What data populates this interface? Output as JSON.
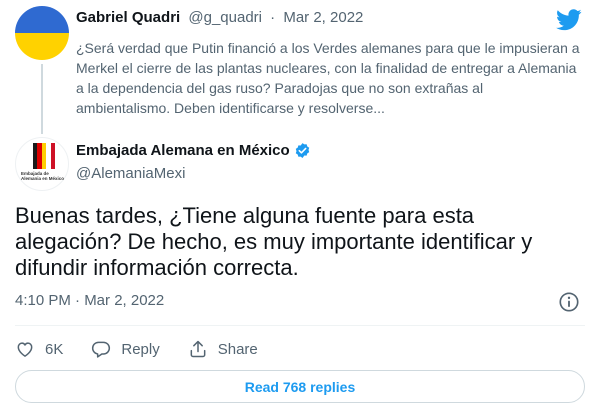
{
  "quoted": {
    "name": "Gabriel Quadri",
    "handle": "@g_quadri",
    "date": "Mar 2, 2022",
    "separator": "·",
    "text": "¿Será verdad que Putin financió a los Verdes alemanes para que le impusieran a Merkel el cierre de las plantas nucleares, con la finalidad de entregar a Alemania a la dependencia del gas ruso? Paradojas que no son extrañas al ambientalismo. Deben identificarse y resolverse..."
  },
  "author": {
    "name": "Embajada Alemana en México",
    "handle": "@AlemaniaMexi",
    "avatar_caption": "Embajada de Alemania en México"
  },
  "tweet": {
    "text": "Buenas tardes, ¿Tiene alguna fuente para esta alegación? De hecho, es muy importante identificar y difundir información correcta.",
    "timestamp": "4:10 PM · Mar 2, 2022"
  },
  "actions": {
    "likes": "6K",
    "reply_label": "Reply",
    "share_label": "Share"
  },
  "read_replies": "Read 768 replies",
  "colors": {
    "accent": "#1d9bf0",
    "muted": "#536471",
    "ukraine_blue": "#2f6ad1",
    "ukraine_yellow": "#ffd200"
  },
  "icons": [
    "twitter-bird-icon",
    "verified-badge-icon",
    "info-icon",
    "heart-icon",
    "reply-icon",
    "share-icon"
  ]
}
